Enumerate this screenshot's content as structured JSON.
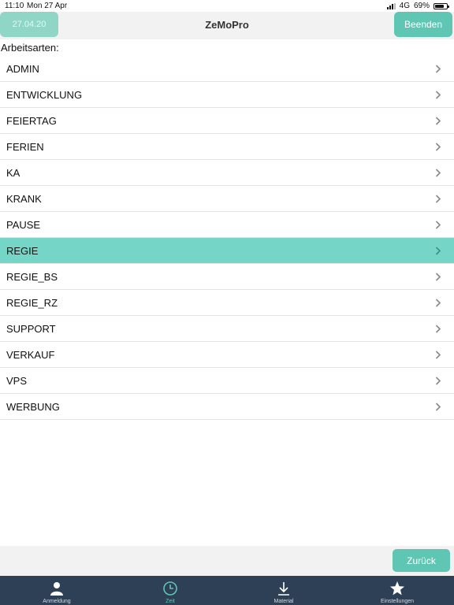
{
  "status_bar": {
    "time": "11:10",
    "date": "Mon 27 Apr",
    "network": "4G",
    "battery": "69%",
    "battery_level": 0.69
  },
  "nav": {
    "date_label": "27.04.20",
    "title": "ZeMoPro",
    "end_label": "Beenden"
  },
  "section_label": "Arbeitsarten:",
  "list": {
    "items": [
      {
        "label": "ADMIN"
      },
      {
        "label": "ENTWICKLUNG"
      },
      {
        "label": "FEIERTAG"
      },
      {
        "label": "FERIEN"
      },
      {
        "label": "KA"
      },
      {
        "label": "KRANK"
      },
      {
        "label": "PAUSE"
      },
      {
        "label": "REGIE",
        "selected": true
      },
      {
        "label": "REGIE_BS"
      },
      {
        "label": "REGIE_RZ"
      },
      {
        "label": "SUPPORT"
      },
      {
        "label": "VERKAUF"
      },
      {
        "label": "VPS"
      },
      {
        "label": "WERBUNG"
      }
    ]
  },
  "bottom": {
    "back_label": "Zurück"
  },
  "tabs": [
    {
      "label": "Anmeldung",
      "icon": "person-icon",
      "active": false
    },
    {
      "label": "Zeit",
      "icon": "clock-icon",
      "active": true
    },
    {
      "label": "Material",
      "icon": "download-icon",
      "active": false
    },
    {
      "label": "Einstellungen",
      "icon": "star-icon",
      "active": false
    }
  ],
  "colors": {
    "accent": "#5fc6b3",
    "selected_row": "#75d5c6",
    "tab_bar": "#2e4056"
  }
}
